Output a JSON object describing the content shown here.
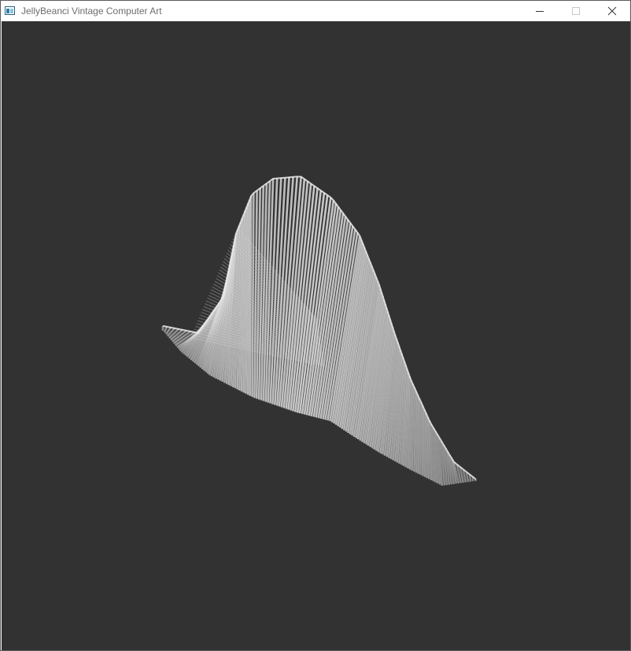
{
  "window": {
    "title": "JellyBeanci Vintage Computer Art",
    "controls": {
      "minimize_icon": "minimize-icon",
      "maximize_icon": "maximize-icon",
      "close_icon": "close-icon"
    }
  },
  "canvas": {
    "background": "#323232",
    "line_color": "#d9d9d9",
    "artwork": "generative line surface"
  }
}
